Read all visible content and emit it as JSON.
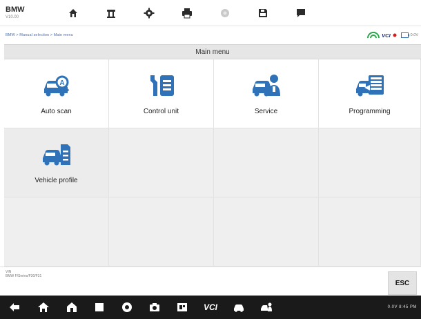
{
  "app": {
    "brand": "BMW",
    "version": "V10.00"
  },
  "toolbar": {
    "icons": [
      "home-icon",
      "vehicle-lift-icon",
      "settings-icon",
      "print-icon",
      "help-icon",
      "save-icon",
      "message-icon"
    ]
  },
  "breadcrumb": "BMW > Manual selection > Main menu",
  "status_row": {
    "vci_label": "VCI",
    "battery_label": "0.0V"
  },
  "title": "Main menu",
  "menu": {
    "items": [
      {
        "label": "Auto scan",
        "icon": "auto-scan-icon"
      },
      {
        "label": "Control unit",
        "icon": "control-unit-icon"
      },
      {
        "label": "Service",
        "icon": "service-icon"
      },
      {
        "label": "Programming",
        "icon": "programming-icon"
      },
      {
        "label": "Vehicle profile",
        "icon": "vehicle-profile-icon"
      }
    ]
  },
  "footer": {
    "vin_label": "VIN",
    "vin_value": "BMW F/Series/F30/F31",
    "esc_label": "ESC"
  },
  "navbar": {
    "vci_label": "VCI",
    "status_text": "0.0V 8:45 PM"
  },
  "colors": {
    "accent": "#2f72b7",
    "vci_arc": "#2aa84a",
    "vci_dot": "#d0201d",
    "navbar": "#1a1a1a"
  }
}
